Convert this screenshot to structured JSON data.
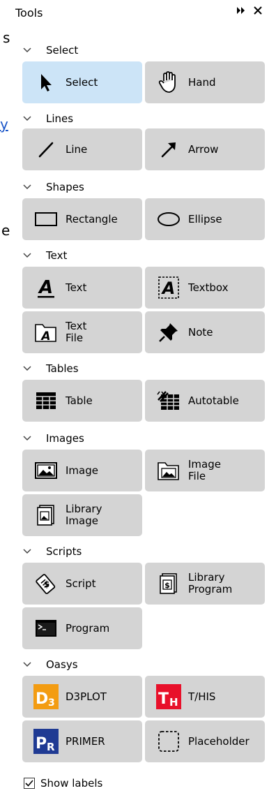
{
  "background": {
    "frag_1": "s",
    "frag_2": "y",
    "frag_3": "e"
  },
  "panel": {
    "title": "Tools",
    "pin_icon": "double-arrow-icon",
    "close_icon": "close-icon"
  },
  "sections": {
    "select": {
      "label": "Select"
    },
    "lines": {
      "label": "Lines"
    },
    "shapes": {
      "label": "Shapes"
    },
    "text": {
      "label": "Text"
    },
    "tables": {
      "label": "Tables"
    },
    "images": {
      "label": "Images"
    },
    "scripts": {
      "label": "Scripts"
    },
    "oasys": {
      "label": "Oasys"
    }
  },
  "tools": {
    "select": "Select",
    "hand": "Hand",
    "line": "Line",
    "arrow": "Arrow",
    "rectangle": "Rectangle",
    "ellipse": "Ellipse",
    "text": "Text",
    "textbox": "Textbox",
    "text_file": "Text\nFile",
    "note": "Note",
    "table": "Table",
    "autotable": "Autotable",
    "image": "Image",
    "image_file": "Image\nFile",
    "library_image": "Library\nImage",
    "script": "Script",
    "library_program": "Library\nProgram",
    "program": "Program",
    "d3plot": "D3PLOT",
    "this": "T/HIS",
    "primer": "PRIMER",
    "placeholder": "Placeholder"
  },
  "brand_logos": {
    "d3plot": {
      "text": "D3",
      "color": "#f39c12"
    },
    "this": {
      "text": "TH",
      "color": "#e8102a"
    },
    "primer": {
      "text": "PR",
      "color": "#1f3a93"
    }
  },
  "footer": {
    "show_labels": "Show labels",
    "checked": true
  },
  "colors": {
    "button_bg": "#d4d4d4",
    "selected_bg": "#cce4f7"
  }
}
